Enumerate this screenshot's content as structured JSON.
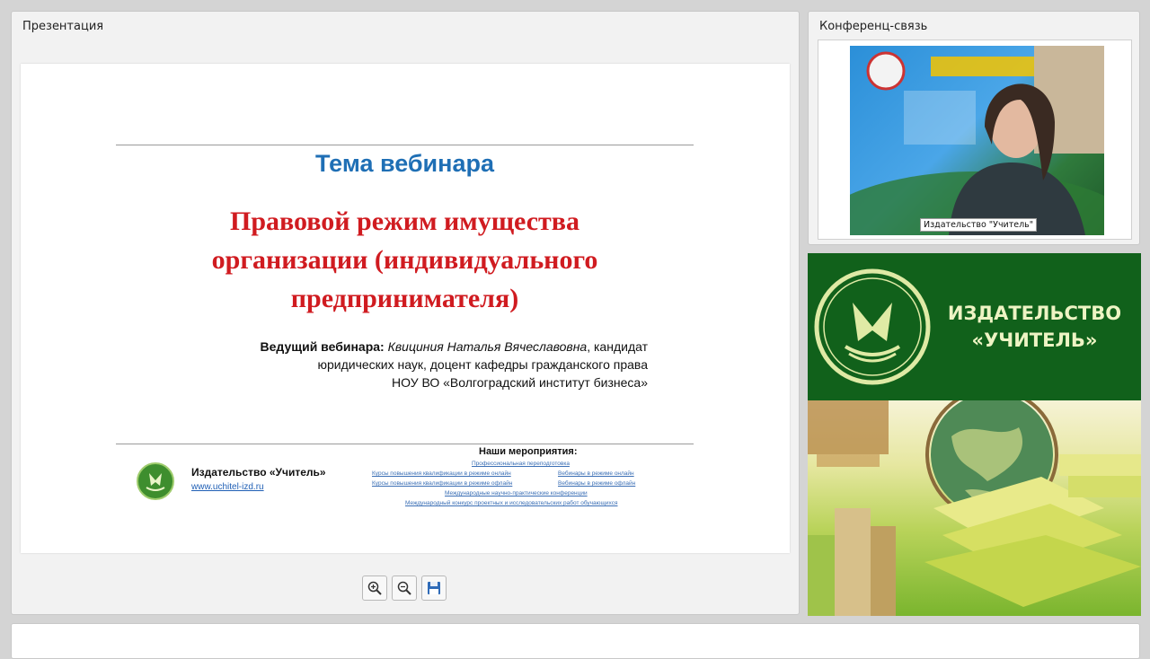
{
  "presentation_panel": {
    "title": "Презентация",
    "slide": {
      "topic": "Тема вебинара",
      "title_lines": [
        "Правовой режим имущества",
        "организации (индивидуального",
        "предпринимателя)"
      ],
      "presenter_label": "Ведущий вебинара:",
      "presenter_name": "Квициния Наталья Вячеславовна",
      "presenter_desc_1": ", кандидат",
      "presenter_desc_2": "юридических наук, доцент кафедры гражданского права",
      "presenter_desc_3": "НОУ ВО «Волгоградский институт бизнеса»",
      "publisher_name": "Издательство «Учитель»",
      "publisher_url": "www.uchitel-izd.ru",
      "events_title": "Наши мероприятия:",
      "events": [
        "Профессиональная переподготовка",
        "Курсы повышения квалификации в режиме онлайн",
        "Вебинары в режиме онлайн",
        "Курсы повышения квалификации в режиме офлайн",
        "Вебинары в режиме офлайн",
        "Международные научно-практические конференции",
        "Международный конкурс проектных и исследовательских работ обучающихся"
      ]
    },
    "toolbar": {
      "zoom_in_icon": "zoom-in-icon",
      "zoom_out_icon": "zoom-out-icon",
      "save_icon": "floppy-disk-icon"
    }
  },
  "conference_panel": {
    "title": "Конференц-связь",
    "video_label": "Издательство \"Учитель\""
  },
  "publisher_banner": {
    "line1": "ИЗДАТЕЛЬСТВО",
    "line2": "«УЧИТЕЛЬ»"
  },
  "colors": {
    "topic": "#1f6fb5",
    "title": "#d01b20",
    "banner_green": "#11611b",
    "banner_text": "#eef4c4"
  }
}
